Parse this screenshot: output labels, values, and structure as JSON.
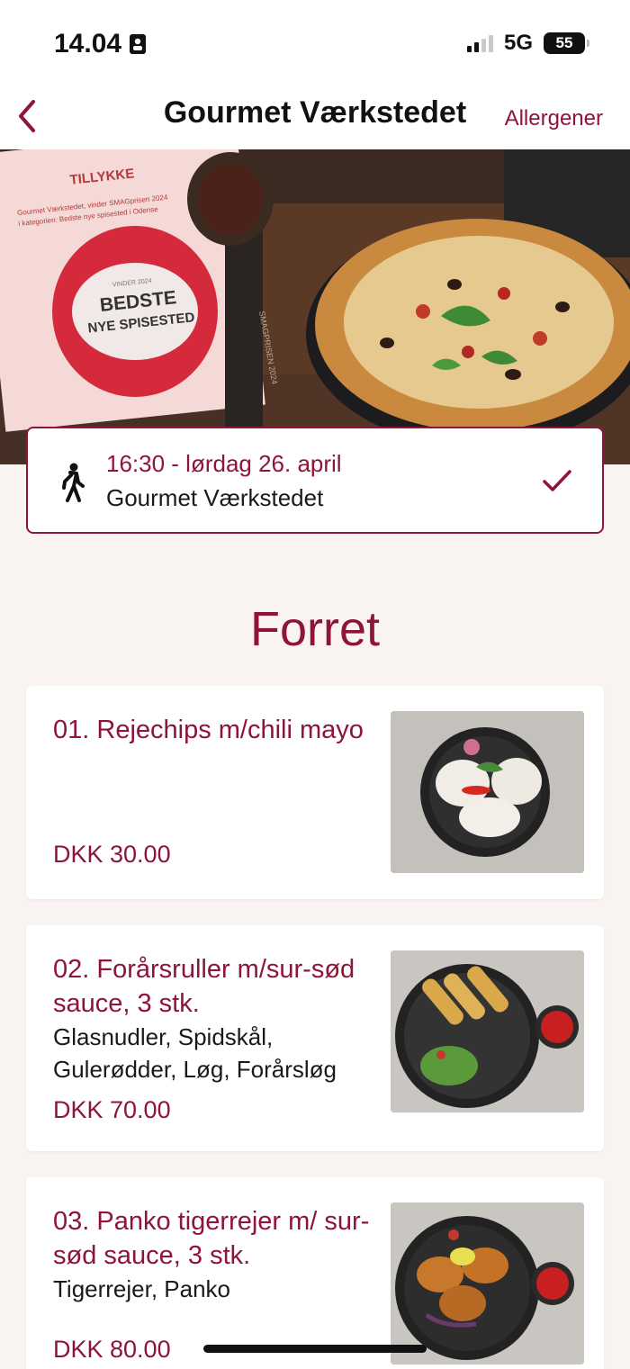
{
  "status_bar": {
    "time": "14.04",
    "network": "5G",
    "battery": "55"
  },
  "nav": {
    "title": "Gourmet Værkstedet",
    "allergen_link": "Allergener"
  },
  "hero": {
    "sign_header": "TILLYKKE",
    "sign_text_line1": "Gourmet Værkstedet, vinder SMAGprisen 2024",
    "sign_text_line2": "i kategorien: Bedste nye spisested i Odense",
    "badge_small": "VINDER 2024",
    "badge_line1": "BEDSTE",
    "badge_line2": "NYE SPISESTED",
    "trophy_text": "SMAGPRISEN 2024"
  },
  "booking": {
    "time": "16:30 - lørdag 26. april",
    "place": "Gourmet Værkstedet"
  },
  "section": {
    "title": "Forret"
  },
  "items": [
    {
      "name": "01. Rejechips m/chili mayo",
      "desc": "",
      "price": "DKK 30.00"
    },
    {
      "name": "02. Forårsruller m/sur-sød sauce, 3 stk.",
      "desc": "Glasnudler, Spidskål, Gulerødder, Løg, Forårsløg",
      "price": "DKK 70.00"
    },
    {
      "name": "03. Panko tigerrejer m/ sur-sød sauce, 3 stk.",
      "desc": "Tigerrejer, Panko",
      "price": "DKK 80.00"
    }
  ],
  "colors": {
    "accent": "#8e1438",
    "background": "#f9f4f2",
    "card": "#ffffff"
  },
  "icons": {
    "back": "chevron-left-icon",
    "walk": "walking-person-icon",
    "check": "checkmark-icon",
    "badge": "id-badge-icon"
  }
}
